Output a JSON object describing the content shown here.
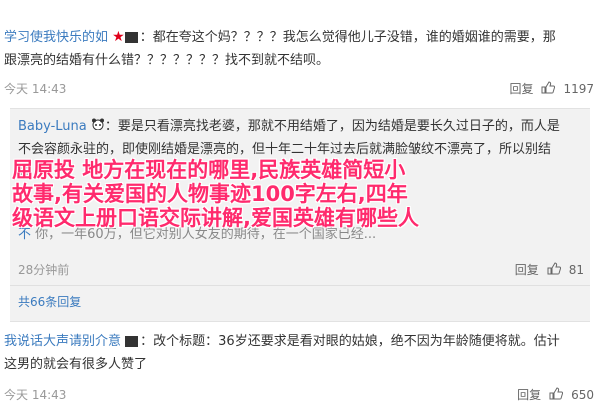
{
  "post1": {
    "username": "学习使我快乐的如",
    "text_line1": "：都在夸这个妈？？？？我怎么觉得他儿子没错，谁的婚姻谁的需要，那",
    "text_line2": "跟漂亮的结婚有什么错？？？？？？？找不到就不结呗。",
    "time": "今天 14:43",
    "reply_label": "回复",
    "likes": "1197"
  },
  "reply1": {
    "username": "Baby-Luna",
    "line1": "：要是只看漂亮找老婆，那就不用结婚了，因为结婚是要长久过日子的，而人是",
    "line2": "不会容颜永驻的，即使刚结婚是漂亮的，但十年二十年过去后就满脸皱纹不漂亮了，所以别结",
    "line3": "婚",
    "partial_name": "不",
    "partial_line": "你，一年60万，但它对别人女友的期待，在一个国家已经...",
    "time": "28分钟前",
    "reply_label": "回复",
    "likes": "81",
    "more_replies": "共66条回复"
  },
  "post2": {
    "username": "我说话大声请别介意",
    "text_line1": "：改个标题：36岁还要求是看对眼的姑娘，绝不因为年龄随便将就。估计",
    "text_line2": "这男的就会有很多人赞了",
    "time": "今天 14:43",
    "reply_label": "回复",
    "likes": "650"
  },
  "overlay": {
    "line1": "屈原投 地方在现在的哪里,民族英雄简短小",
    "line2": "故事,有关爱国的人物事迹100字左右,四年",
    "line3": " 级语文上册口语交际讲解,爱国英雄有哪些人"
  },
  "colors": {
    "link_blue": "#3b7bbf",
    "overlay_pink": "#ff2a6d",
    "star_red": "#e0001b"
  }
}
